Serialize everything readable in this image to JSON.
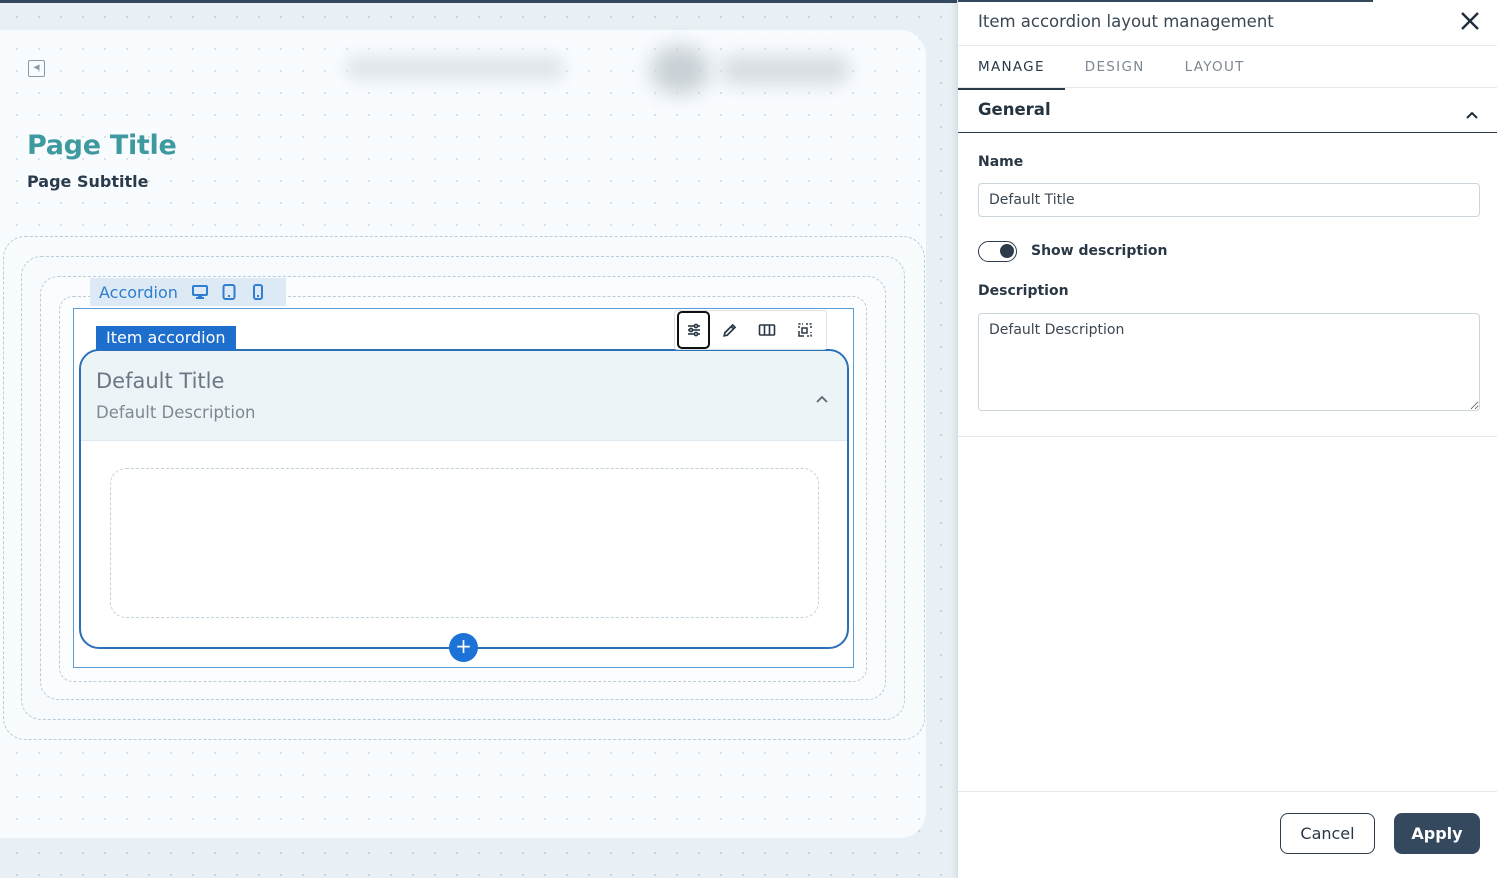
{
  "canvas": {
    "page_title": "Page Title",
    "page_subtitle": "Page Subtitle",
    "accordion_tag": {
      "label": "Accordion",
      "devices": [
        "desktop-icon",
        "tablet-icon",
        "mobile-icon"
      ]
    },
    "item": {
      "tag_label": "Item accordion",
      "toolbar": [
        "settings-sliders-icon",
        "edit-pencil-icon",
        "columns-icon",
        "move-icon"
      ],
      "title": "Default Title",
      "description": "Default Description",
      "add_label": "+"
    }
  },
  "panel": {
    "title": "Item accordion layout management",
    "tabs": [
      {
        "label": "MANAGE",
        "active": true
      },
      {
        "label": "DESIGN",
        "active": false
      },
      {
        "label": "LAYOUT",
        "active": false
      }
    ],
    "section": {
      "title": "General",
      "name_label": "Name",
      "name_value": "Default Title",
      "toggle_label": "Show description",
      "toggle_on": true,
      "description_label": "Description",
      "description_value": "Default Description"
    },
    "footer": {
      "cancel_label": "Cancel",
      "apply_label": "Apply"
    }
  },
  "colors": {
    "accent": "#3f9aa0",
    "primary": "#1e6fcd",
    "dark": "#34495e"
  }
}
